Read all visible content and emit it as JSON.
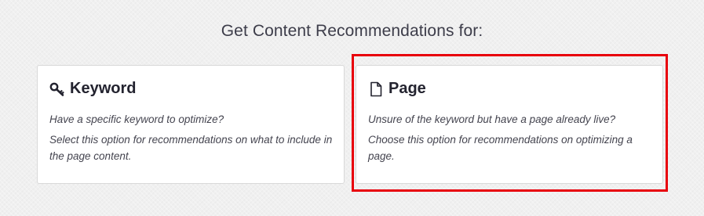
{
  "heading": "Get Content Recommendations for:",
  "options": [
    {
      "title": "Keyword",
      "icon": "key-icon",
      "question": "Have a specific keyword to optimize?",
      "description": "Select this option for recommendations on what to include in the page content.",
      "selected": false
    },
    {
      "title": "Page",
      "icon": "document-icon",
      "question": "Unsure of the keyword but have a page already live?",
      "description": "Choose this option for recommendations on optimizing a page.",
      "selected": true
    }
  ],
  "colors": {
    "selection_outline": "#e8000b",
    "card_background": "#ffffff",
    "page_background": "#f0f0f0"
  }
}
